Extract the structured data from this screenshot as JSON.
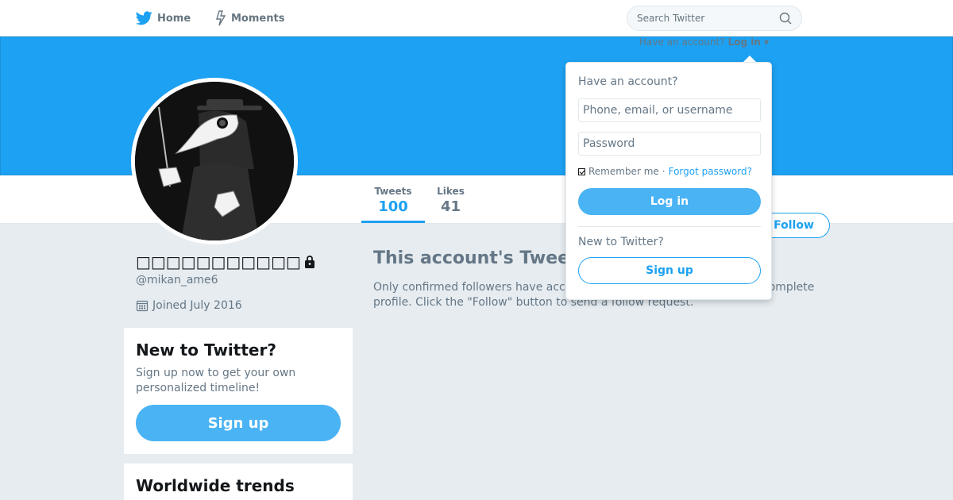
{
  "nav": {
    "home_label": "Home",
    "moments_label": "Moments",
    "search_placeholder": "Search Twitter",
    "have_account_text": "Have an account?",
    "login_link": "Log in"
  },
  "profile": {
    "display_name": "□□□□□□□□□□□",
    "handle": "@mikan_ame6",
    "joined": "Joined July 2016",
    "stats": [
      {
        "label": "Tweets",
        "value": "100"
      },
      {
        "label": "Likes",
        "value": "41"
      }
    ],
    "follow_label": "Follow"
  },
  "protected": {
    "title": "This account's Tweets are protected.",
    "text": "Only confirmed followers have access to @mikan_ame6's Tweets and complete profile. Click the \"Follow\" button to send a follow request."
  },
  "signup_card": {
    "title": "New to Twitter?",
    "text": "Sign up now to get your own personalized timeline!",
    "button": "Sign up"
  },
  "trends_card": {
    "title": "Worldwide trends"
  },
  "login_dropdown": {
    "heading": "Have an account?",
    "username_placeholder": "Phone, email, or username",
    "password_placeholder": "Password",
    "remember_label": "Remember me",
    "separator": "·",
    "forgot_label": "Forgot password?",
    "login_button": "Log in",
    "new_heading": "New to Twitter?",
    "signup_button": "Sign up"
  },
  "colors": {
    "brand_blue": "#1da1f2",
    "button_blue": "#4ab3f4",
    "page_bg": "#e6ecf0"
  }
}
